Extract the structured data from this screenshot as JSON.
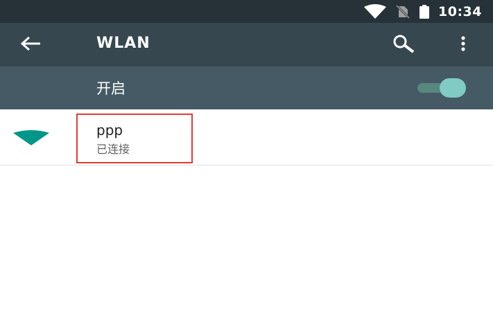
{
  "status_bar": {
    "time": "10:34",
    "icons": [
      "wifi-signal-icon",
      "no-sim-icon",
      "battery-icon"
    ]
  },
  "app_bar": {
    "title": "WLAN",
    "back_icon": "arrow-back-icon",
    "search_icon": "search-icon",
    "more_icon": "more-vert-icon"
  },
  "switch": {
    "label": "开启",
    "state": "on"
  },
  "networks": [
    {
      "name": "ppp",
      "status": "已连接",
      "icon": "wifi-signal-icon"
    }
  ],
  "colors": {
    "status_bar_bg": "#263238",
    "app_bar_bg": "#37474f",
    "switch_bar_bg": "#455a64",
    "accent": "#009688",
    "toggle_thumb": "#80cbc4",
    "highlight": "#e53935"
  }
}
